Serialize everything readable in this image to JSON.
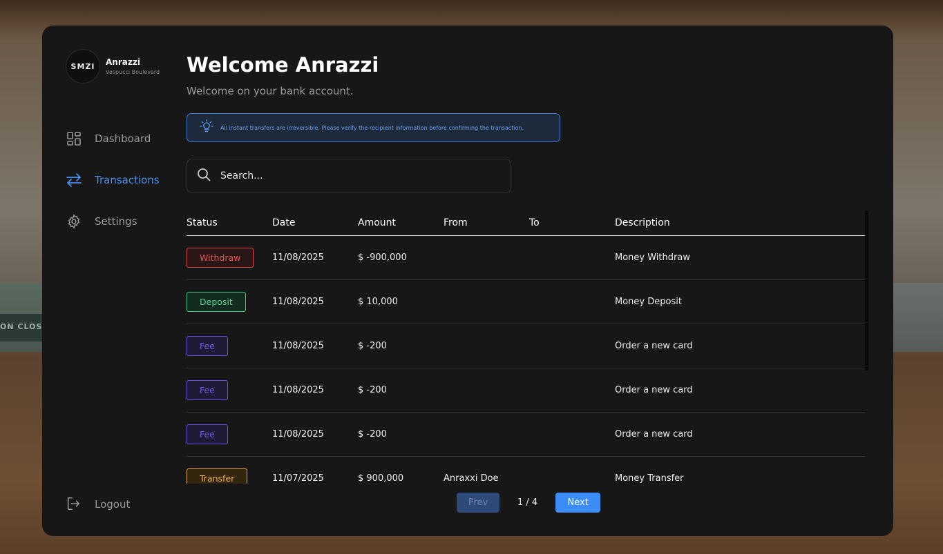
{
  "profile": {
    "avatar_text": "SMZI",
    "name": "Anrazzi",
    "location": "Vespucci Boulevard"
  },
  "nav": [
    {
      "label": "Dashboard",
      "icon": "dashboard-icon",
      "active": false
    },
    {
      "label": "Transactions",
      "icon": "transfer-arrows-icon",
      "active": true
    },
    {
      "label": "Settings",
      "icon": "gear-icon",
      "active": false
    }
  ],
  "logout_label": "Logout",
  "header": {
    "title": "Welcome Anrazzi",
    "subtitle": "Welcome on your bank account."
  },
  "notice": {
    "icon": "lightbulb-icon",
    "text": "All instant transfers are irreversible. Please verify the recipient information before confirming the transaction."
  },
  "search": {
    "placeholder": "Search...",
    "icon": "search-icon"
  },
  "table": {
    "columns": [
      "Status",
      "Date",
      "Amount",
      "From",
      "To",
      "Description"
    ],
    "rows": [
      {
        "status": "Withdraw",
        "date": "11/08/2025",
        "amount": "$ -900,000",
        "from": "",
        "to": "",
        "description": "Money Withdraw"
      },
      {
        "status": "Deposit",
        "date": "11/08/2025",
        "amount": "$ 10,000",
        "from": "",
        "to": "",
        "description": "Money Deposit"
      },
      {
        "status": "Fee",
        "date": "11/08/2025",
        "amount": "$ -200",
        "from": "",
        "to": "",
        "description": "Order a new card"
      },
      {
        "status": "Fee",
        "date": "11/08/2025",
        "amount": "$ -200",
        "from": "",
        "to": "",
        "description": "Order a new card"
      },
      {
        "status": "Fee",
        "date": "11/08/2025",
        "amount": "$ -200",
        "from": "",
        "to": "",
        "description": "Order a new card"
      },
      {
        "status": "Transfer",
        "date": "11/07/2025",
        "amount": "$ 900,000",
        "from": "Anraxxi Doe",
        "to": "",
        "description": "Money Transfer"
      }
    ]
  },
  "pagination": {
    "prev_label": "Prev",
    "next_label": "Next",
    "page_text": "1 / 4"
  },
  "background": {
    "sign_text": "ON CLOS"
  },
  "colors": {
    "accent": "#3b8df5",
    "panel": "#171717",
    "withdraw": "#d94b4b",
    "deposit": "#44c384",
    "fee": "#6a4ee0",
    "transfer": "#e7a948"
  }
}
